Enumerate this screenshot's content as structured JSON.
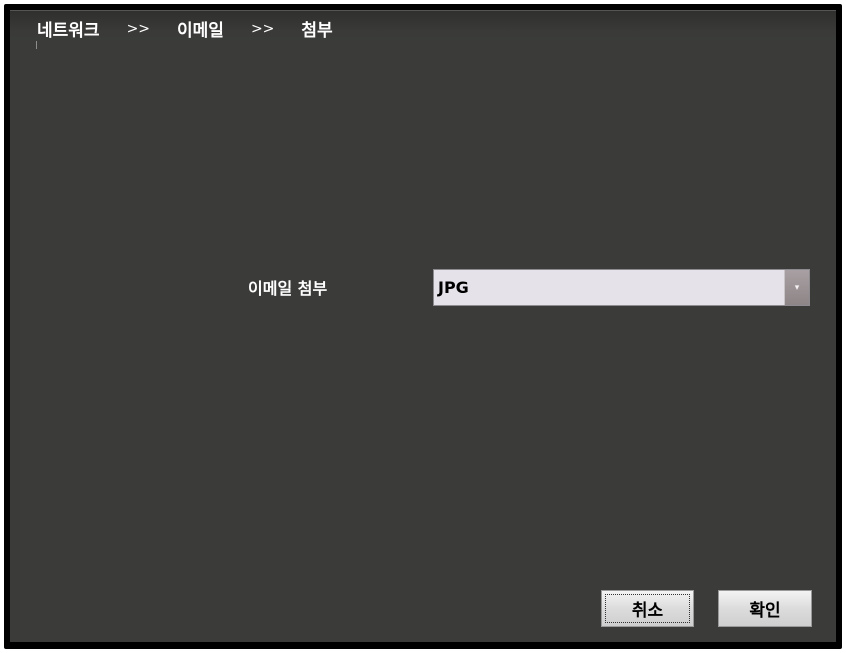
{
  "breadcrumb": {
    "items": [
      "네트워크",
      "이메일",
      "첨부"
    ],
    "separator": ">>"
  },
  "form": {
    "attachment_label": "이메일 첨부",
    "attachment_value": "JPG",
    "dropdown_icon": "chevron-down-icon"
  },
  "buttons": {
    "cancel": "취소",
    "ok": "확인"
  },
  "colors": {
    "background": "#3b3c3a",
    "frame": "#000000",
    "select_bg": "#e6e2ea"
  }
}
